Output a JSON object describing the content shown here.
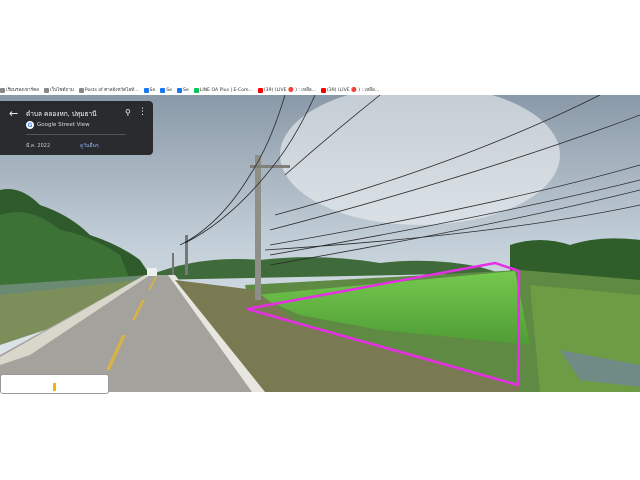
{
  "bookmarks": [
    {
      "label": "เรียนรองเขาร์คล",
      "icon": "globe-icon",
      "color": "#777777"
    },
    {
      "label": "เว็บไซต์ถาม",
      "icon": "globe-icon",
      "color": "#777777"
    },
    {
      "label": "Posts of ศาลจังหวัดไอท์...",
      "icon": "globe-icon",
      "color": "#777777"
    },
    {
      "label": "Se",
      "icon": "facebook-icon",
      "color": "#1877f2"
    },
    {
      "label": "Se",
      "icon": "facebook-icon",
      "color": "#1877f2"
    },
    {
      "label": "Se",
      "icon": "facebook-icon",
      "color": "#1877f2"
    },
    {
      "label": "LINE OA Plus | E-Com...",
      "icon": "line-icon",
      "color": "#06c755"
    },
    {
      "label": "(39) (LIVE 🔴 ) : เหลือ...",
      "icon": "youtube-icon",
      "color": "#ff0000"
    },
    {
      "label": "(39) (LIVE 🔴 ) : เหลือ...",
      "icon": "youtube-icon",
      "color": "#ff0000"
    }
  ],
  "panel": {
    "place_name": "ตำบล คลองหก, ปทุมธานี",
    "source": "Google Street View",
    "date": "มี.ค. 2022",
    "more_dates": "ดูวันอื่นๆ"
  },
  "overlay_color": "#e62ee6"
}
